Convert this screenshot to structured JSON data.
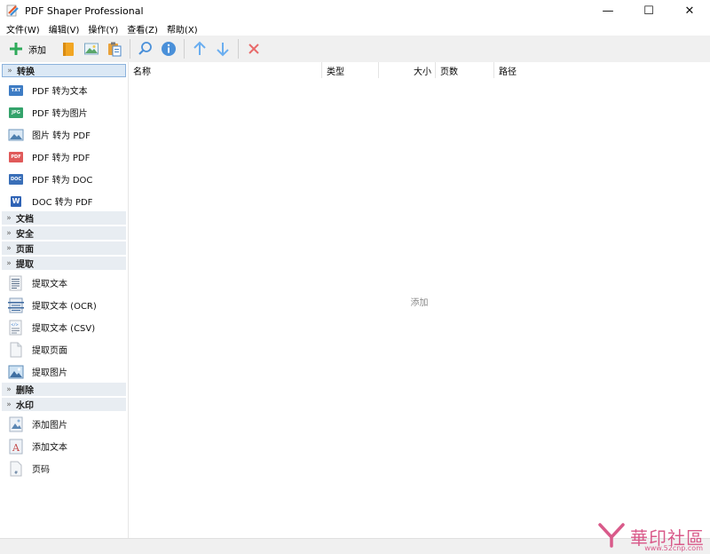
{
  "window": {
    "title": "PDF Shaper Professional",
    "minimize": "—",
    "maximize": "☐",
    "close": "✕"
  },
  "menu": [
    "文件(W)",
    "编辑(V)",
    "操作(Y)",
    "查看(Z)",
    "帮助(X)"
  ],
  "toolbar": {
    "add_label": "添加",
    "buttons": [
      "add-icon",
      "open-folder-icon",
      "image-icon",
      "clipboard-icon",
      "search-icon",
      "info-icon",
      "arrow-up-icon",
      "arrow-down-icon",
      "delete-icon"
    ]
  },
  "sidebar": {
    "groups": [
      {
        "label": "转换",
        "expanded": true,
        "items": [
          {
            "label": "PDF 转为文本",
            "icon": "txt-file-icon",
            "badge": "TXT"
          },
          {
            "label": "PDF 转为图片",
            "icon": "jpg-file-icon",
            "badge": "JPG"
          },
          {
            "label": "图片 转为 PDF",
            "icon": "image-to-pdf-icon"
          },
          {
            "label": "PDF 转为 PDF",
            "icon": "pdf-file-icon",
            "badge": "PDF"
          },
          {
            "label": "PDF 转为 DOC",
            "icon": "doc-file-icon",
            "badge": "DOC"
          },
          {
            "label": "DOC 转为 PDF",
            "icon": "word-file-icon",
            "badge": "W"
          }
        ]
      },
      {
        "label": "文档",
        "expanded": false
      },
      {
        "label": "安全",
        "expanded": false
      },
      {
        "label": "页面",
        "expanded": false
      },
      {
        "label": "提取",
        "expanded": true,
        "items": [
          {
            "label": "提取文本",
            "icon": "text-page-icon"
          },
          {
            "label": "提取文本 (OCR)",
            "icon": "ocr-page-icon"
          },
          {
            "label": "提取文本 (CSV)",
            "icon": "csv-page-icon"
          },
          {
            "label": "提取页面",
            "icon": "blank-page-icon"
          },
          {
            "label": "提取图片",
            "icon": "picture-icon"
          }
        ]
      },
      {
        "label": "删除",
        "expanded": false
      },
      {
        "label": "水印",
        "expanded": true,
        "items": [
          {
            "label": "添加图片",
            "icon": "image-watermark-icon"
          },
          {
            "label": "添加文本",
            "icon": "text-watermark-icon"
          },
          {
            "label": "页码",
            "icon": "page-number-icon"
          }
        ]
      }
    ]
  },
  "list": {
    "columns": [
      "名称",
      "类型",
      "大小",
      "页数",
      "路径"
    ],
    "empty_text": "添加"
  },
  "watermark": {
    "text": "華印社區",
    "url": "www.52cnp.com"
  },
  "colors": {
    "toolbar_bg": "#f0f0f0",
    "group_bg": "#e8edf2",
    "active_group_border": "#8cb2dc",
    "accent_green": "#2eaa5a",
    "accent_blue": "#3a8ee0",
    "accent_red": "#e05a5a"
  }
}
